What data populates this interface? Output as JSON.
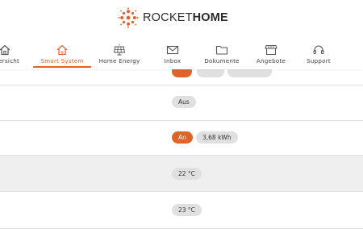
{
  "brand": {
    "part1": "ROCKET",
    "part2": "HOME"
  },
  "nav": [
    {
      "label": "Übersicht",
      "icon": "home-icon"
    },
    {
      "label": "Smart System",
      "icon": "smart-home-icon",
      "active": true
    },
    {
      "label": "Home Energy",
      "icon": "solar-panel-icon"
    },
    {
      "label": "Inbox",
      "icon": "envelope-icon"
    },
    {
      "label": "Dokumente",
      "icon": "folder-icon"
    },
    {
      "label": "Angebote",
      "icon": "store-icon"
    },
    {
      "label": "Support",
      "icon": "headset-icon"
    }
  ],
  "rows": [
    {
      "status": "Aus"
    },
    {
      "status": "An",
      "value": "3,68 kWh"
    },
    {
      "value": "22 °C"
    },
    {
      "value": "23 °C"
    }
  ],
  "colors": {
    "accent": "#e0632a",
    "row_shaded": "#efefef",
    "pill_bg": "#e0e0e0"
  }
}
